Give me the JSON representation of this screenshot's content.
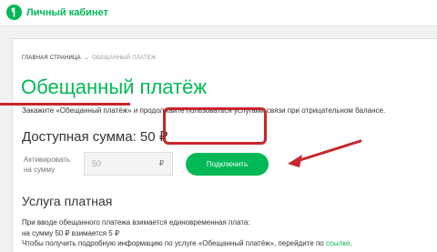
{
  "header": {
    "logo_text": "Личный кабинет",
    "brand_color": "#00b956"
  },
  "breadcrumb": {
    "home": "ГЛАВНАЯ СТРАНИЦА",
    "separator": "→",
    "current": "ОБЕЩАННЫЙ ПЛАТЁЖ"
  },
  "page": {
    "title": "Обещанный платёж",
    "description": "Закажите «Обещанный платёж» и продолжайте пользоваться услугами связи при отрицательном балансе."
  },
  "available": {
    "label": "Доступная сумма:",
    "amount": "50 ₽"
  },
  "activate": {
    "label_line1": "Активировать",
    "label_line2": "на сумму",
    "input_value": "50",
    "currency": "₽",
    "button_label": "Подключить"
  },
  "paid_service": {
    "heading": "Услуга платная",
    "line1": "При вводе обещанного платежа взимается единовременная плата:",
    "line2": "на сумму 50 ₽ взимается 5 ₽",
    "line3": "Чтобы получить подробную информацию по услуге «Обещанный платёж», перейдите по",
    "link": "ссылке",
    "line3_end": "."
  },
  "annotation_color": "#c6262c",
  "icons": [
    "logo-icon",
    "arrow-annotation"
  ]
}
